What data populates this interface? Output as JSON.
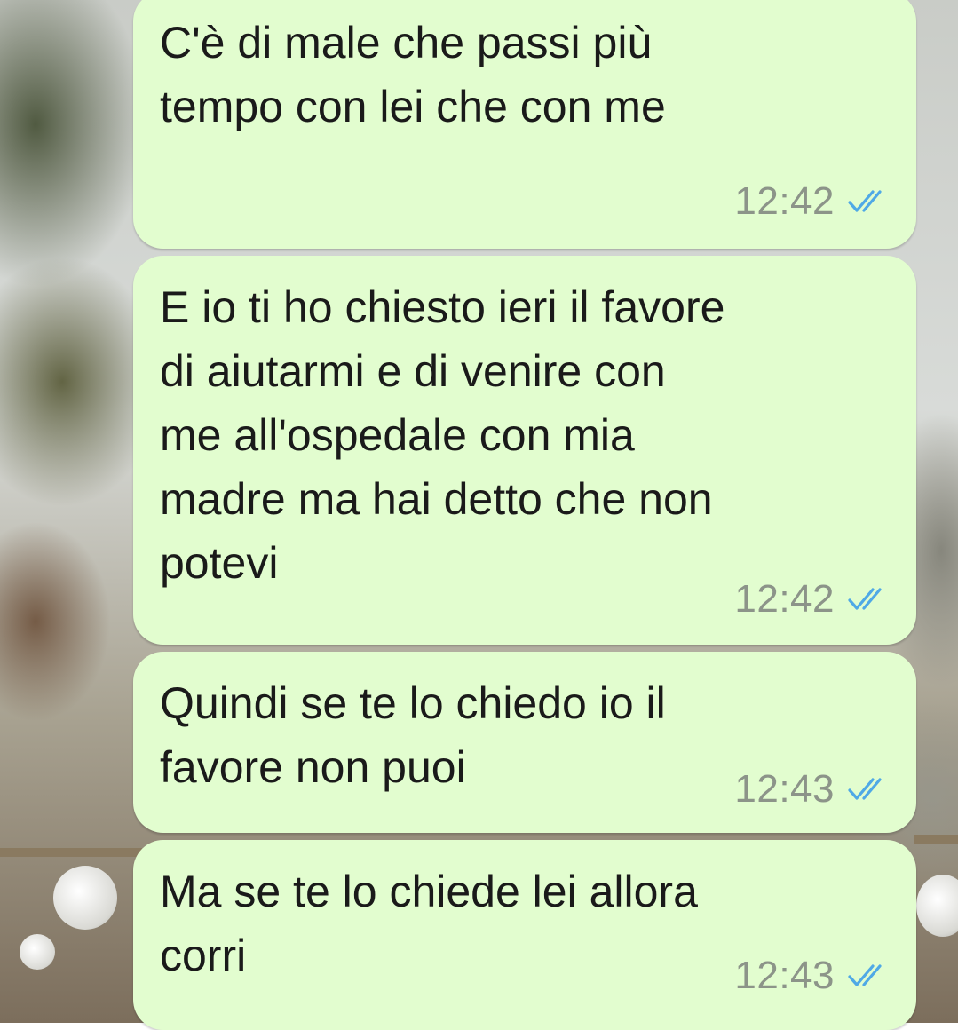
{
  "conversation": {
    "messages": [
      {
        "text": "C'è di male che passi più\ntempo con lei che con me",
        "time": "12:42",
        "status_icon": "double-check-read-icon"
      },
      {
        "text": "E io ti ho chiesto ieri il favore\ndi aiutarmi e di venire con\nme all'ospedale con mia\nmadre ma hai detto che non\npotevi",
        "time": "12:42",
        "status_icon": "double-check-read-icon"
      },
      {
        "text": "Quindi se te lo chiedo io il\nfavore non puoi",
        "time": "12:43",
        "status_icon": "double-check-read-icon"
      },
      {
        "text": "Ma se te lo chiede lei allora\ncorri",
        "time": "12:43",
        "status_icon": "double-check-read-icon"
      }
    ]
  },
  "colors": {
    "bubble_background": "#e2fdcf",
    "message_text": "#1a1a1a",
    "timestamp": "#8c9489",
    "read_ticks": "#4fa9e6"
  }
}
